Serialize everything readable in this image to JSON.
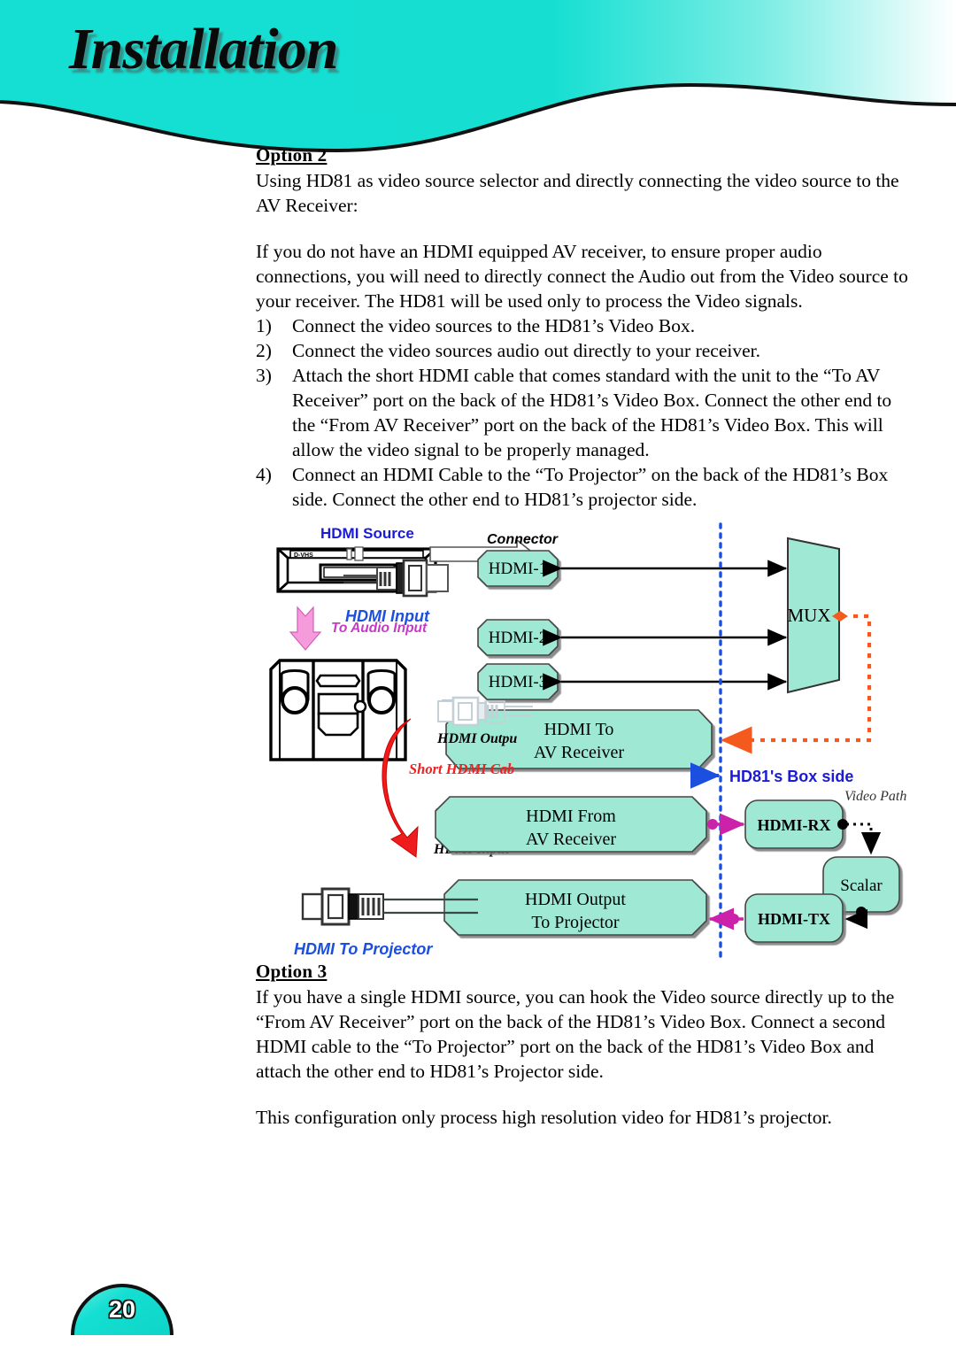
{
  "header": {
    "title": "Installation",
    "banner_color": "#14DFD2",
    "banner_gradient_end": "#ffffff"
  },
  "footer": {
    "page_number": "20",
    "dome_color": "#14DFD2"
  },
  "content": {
    "option2": {
      "heading": "Option 2",
      "intro": "Using HD81 as video source selector and directly connecting the video source to the AV Receiver:",
      "body": "If you do not have an HDMI equipped AV receiver, to ensure proper audio connections, you will need to directly connect the Audio out from the Video source to your receiver.  The HD81 will be used only to process the Video signals.",
      "steps": [
        {
          "num": "1)",
          "text": "Connect the video sources to the HD81’s Video Box."
        },
        {
          "num": "2)",
          "text": "Connect the video sources audio out directly to your receiver."
        },
        {
          "num": "3)",
          "text": "Attach the short HDMI cable that comes standard with the unit to the “To AV Receiver” port on the back of the HD81’s Video Box. Connect the other end to the “From AV Receiver” port on the back of the HD81’s Video Box. This will allow the video signal to be properly managed."
        },
        {
          "num": "4)",
          "text": "Connect an HDMI Cable to the “To Projector” on the back of the HD81’s Box side. Connect the other end to HD81’s projector side."
        }
      ]
    },
    "option3": {
      "heading": "Option 3",
      "body": "If you have a single HDMI source, you can hook the Video source directly up to the “From AV Receiver” port on the back of the HD81’s Video Box. Connect a second HDMI cable to the “To Projector” port on the back of the HD81’s Video Box and attach the other end to HD81’s Projector side.",
      "note": "This configuration only process high resolution video for HD81’s projector."
    }
  },
  "diagram": {
    "colors": {
      "box_fill": "#9FE8D4",
      "box_stroke": "#444444",
      "blue_label": "#1A1AD8",
      "magenta_label": "#CC33CC",
      "red_label": "#EE2222",
      "orange_path": "#F4591E",
      "magenta_arrow": "#CC22AA",
      "divider_blue": "#1A4FE0"
    },
    "labels": {
      "hdmi_source": "HDMI Source",
      "to_audio_input": "To Audio Input",
      "hdmi_input_top": "HDMI Input",
      "connector": "Connector",
      "hdmi_output_mid": "HDMI Outpu",
      "short_hdmi_cable": "Short HDMI Cab",
      "hdmi_input_mid": "HDMI Input",
      "hdmi_to_projector": "HDMI To Projector",
      "hd81_box_side": "HD81's Box side",
      "video_path": "Video Path",
      "device_label": "D-VHS"
    },
    "nodes": {
      "hdmi1": "HDMI-1",
      "hdmi2": "HDMI-2",
      "hdmi3": "HDMI-3",
      "mux": "MUX",
      "hdmi_to_av_l1": "HDMI To",
      "hdmi_to_av_l2": "AV Receiver",
      "hdmi_from_av_l1": "HDMI From",
      "hdmi_from_av_l2": "AV Receiver",
      "hdmi_out_proj_l1": "HDMI Output",
      "hdmi_out_proj_l2": "To Projector",
      "hdmi_rx": "HDMI-RX",
      "hdmi_tx": "HDMI-TX",
      "scalar": "Scalar"
    }
  }
}
